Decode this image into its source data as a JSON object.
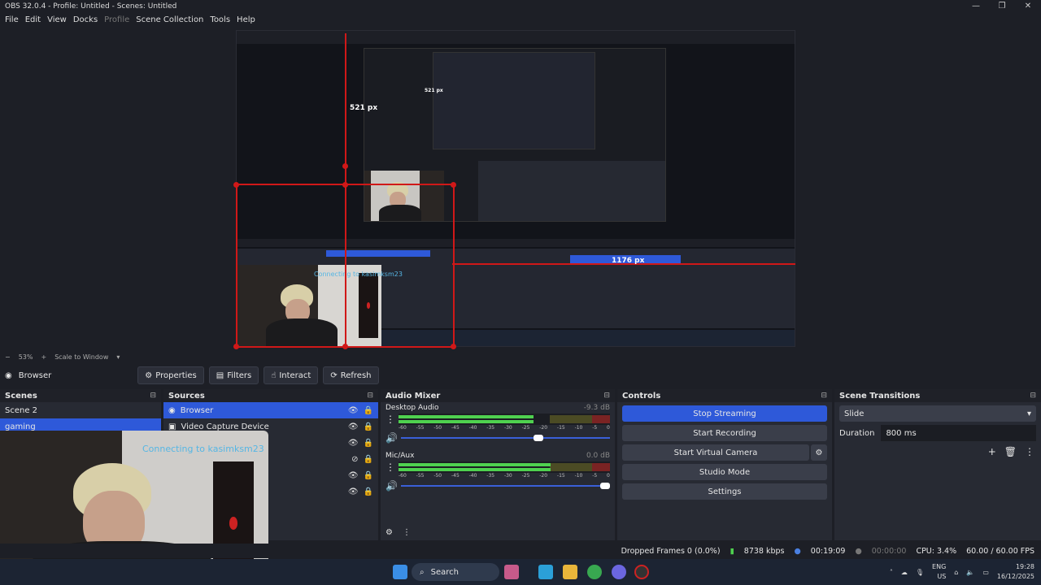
{
  "window": {
    "title": "OBS 32.0.4 - Profile: Untitled - Scenes: Untitled"
  },
  "menu": [
    "File",
    "Edit",
    "View",
    "Docks",
    "Profile",
    "Scene Collection",
    "Tools",
    "Help"
  ],
  "preview": {
    "measure_vertical": "521 px",
    "measure_horizontal": "1176 px",
    "nested_measure": "521 px",
    "overlay_text": "Connecting to kasimksm23",
    "zoom": "53%",
    "scale_mode": "Scale to Window"
  },
  "source_toolbar": {
    "selected_source": "Browser",
    "properties": "Properties",
    "filters": "Filters",
    "interact": "Interact",
    "refresh": "Refresh"
  },
  "scenes": {
    "title": "Scenes",
    "items": [
      "Scene 2",
      "gaming"
    ]
  },
  "sources": {
    "title": "Sources",
    "items": [
      "Browser",
      "Video Capture Device"
    ]
  },
  "mixer": {
    "title": "Audio Mixer",
    "ticks": [
      "-60",
      "-55",
      "-50",
      "-45",
      "-40",
      "-35",
      "-30",
      "-25",
      "-20",
      "-15",
      "-10",
      "-5",
      "0"
    ],
    "channels": [
      {
        "name": "Desktop Audio",
        "db": "-9.3 dB",
        "level": 0.64,
        "volume": 0.68
      },
      {
        "name": "Mic/Aux",
        "db": "0.0 dB",
        "level": 0.72,
        "volume": 1.0
      }
    ]
  },
  "controls": {
    "title": "Controls",
    "stop_streaming": "Stop Streaming",
    "start_recording": "Start Recording",
    "start_virtual_camera": "Start Virtual Camera",
    "studio_mode": "Studio Mode",
    "settings": "Settings"
  },
  "transitions": {
    "title": "Scene Transitions",
    "selected": "Slide",
    "duration_label": "Duration",
    "duration_value": "800 ms"
  },
  "status": {
    "dropped_frames": "Dropped Frames 0 (0.0%)",
    "bitrate": "8738 kbps",
    "stream_time": "00:19:09",
    "record_time": "00:00:00",
    "cpu": "CPU: 3.4%",
    "fps": "60.00 / 60.00 FPS"
  },
  "taskbar": {
    "search": "Search",
    "lang_top": "ENG",
    "lang_bottom": "US",
    "time": "19:28",
    "date": "16/12/2025"
  },
  "colors": {
    "accent": "#2e59d9",
    "guide": "#d01818",
    "panel": "#272a33"
  }
}
